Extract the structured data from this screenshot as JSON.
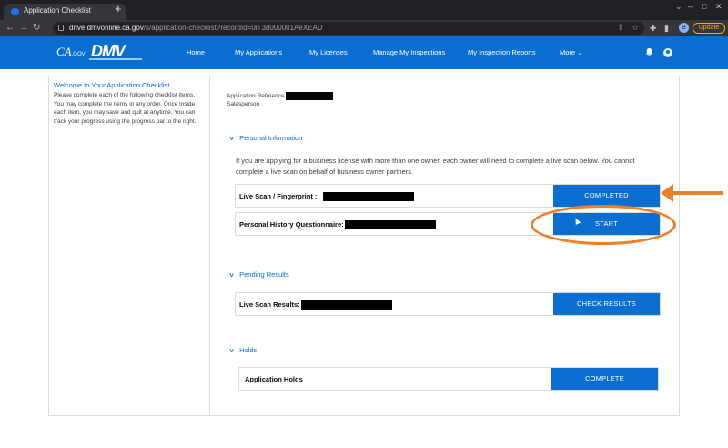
{
  "browser": {
    "tab_title": "Application Checklist",
    "tab_close": "×",
    "new_tab": "+",
    "url_domain": "drive.dmvonline.ca.gov",
    "url_path": "/s/application-checklist?recordId=0iT3d000001AeXEAU",
    "profile_initial": "B",
    "update_label": "Update"
  },
  "site": {
    "ca_logo": "CA",
    "ca_logo_suffix": ".GOV",
    "dmv_logo": "DMV",
    "nav": [
      "Home",
      "My Applications",
      "My Licenses",
      "Manage My Inspections",
      "My Inspection Reports",
      "More"
    ]
  },
  "sidebar": {
    "title": "Welcome to Your Application Checklist",
    "text": "Please complete each of the following checklist items. You may complete the items in any order. Once inside each item, you may save and quit at anytime. You can track your progress using the progress bar to the right."
  },
  "main": {
    "app_ref_label": "Application Reference",
    "salesperson_label": "Salesperson",
    "sections": {
      "personal": {
        "title": "Personal Information",
        "description": "If you are applying for a business license with more than one owner, each owner will need to complete a live scan below. You cannot complete a live scan on behalf of business owner partners.",
        "items": [
          {
            "label": "Live Scan / Fingerprint :",
            "button": "COMPLETED"
          },
          {
            "label": "Personal History Questionnaire:",
            "button": "START"
          }
        ]
      },
      "pending": {
        "title": "Pending Results",
        "items": [
          {
            "label": "Live Scan Results:",
            "button": "CHECK RESULTS"
          }
        ]
      },
      "holds": {
        "title": "Holds",
        "items": [
          {
            "label": "Application Holds",
            "button": "COMPLETE"
          }
        ]
      }
    }
  },
  "colors": {
    "brand_blue": "#0a6ed1",
    "annotation_orange": "#f07e26"
  }
}
